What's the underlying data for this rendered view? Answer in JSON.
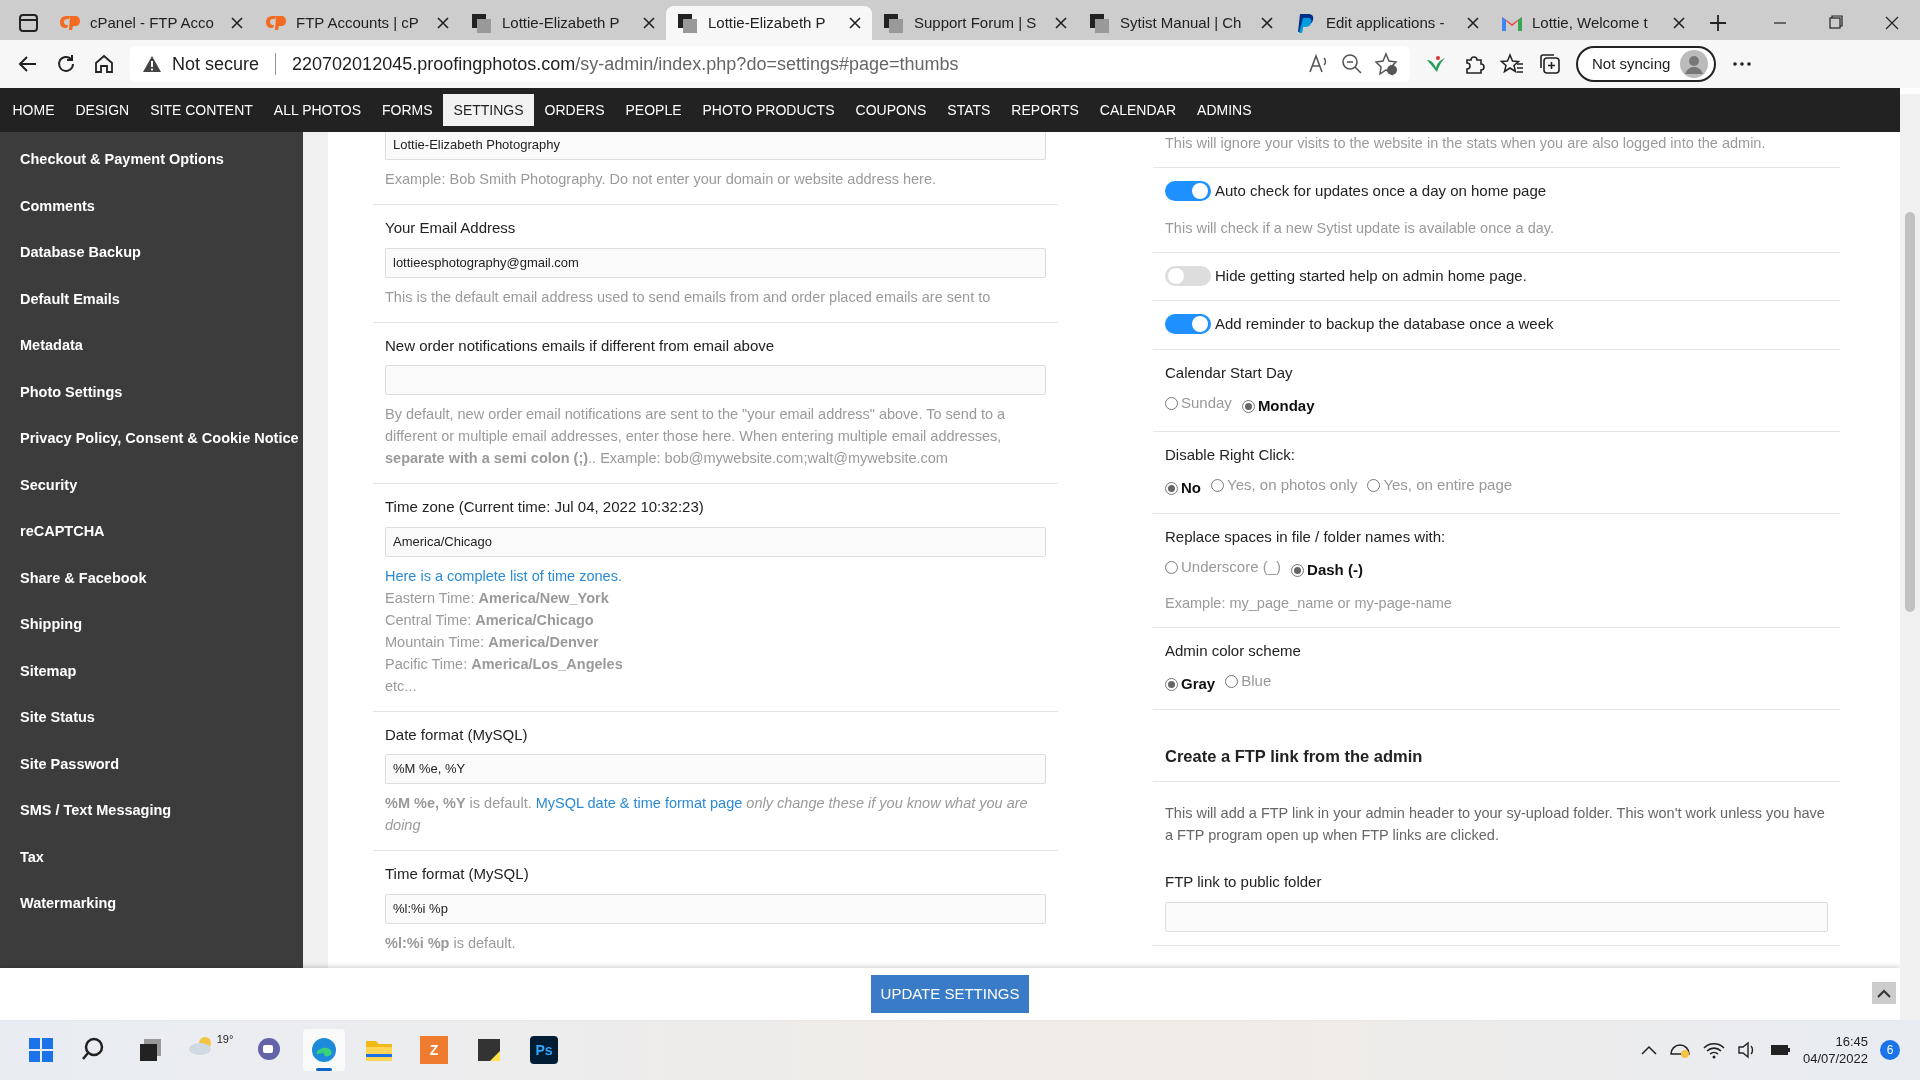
{
  "browser": {
    "tabs": [
      {
        "title": "cPanel - FTP Acco",
        "kind": "cp",
        "selected": false
      },
      {
        "title": "FTP Accounts | cP",
        "kind": "cp",
        "selected": false
      },
      {
        "title": "Lottie-Elizabeth P",
        "kind": "page",
        "selected": false
      },
      {
        "title": "Lottie-Elizabeth P",
        "kind": "page",
        "selected": true
      },
      {
        "title": "Support Forum | S",
        "kind": "page",
        "selected": false
      },
      {
        "title": "Sytist Manual | Ch",
        "kind": "page",
        "selected": false
      },
      {
        "title": "Edit applications -",
        "kind": "pp",
        "selected": false
      },
      {
        "title": "Lottie, Welcome t",
        "kind": "mail",
        "selected": false
      }
    ],
    "security": "Not secure",
    "url_host": "220702012045.proofingphotos.com",
    "url_path": "/sy-admin/index.php?do=settings#page=thumbs",
    "profile": "Not syncing"
  },
  "admin_nav": [
    {
      "label": "HOME",
      "selected": false
    },
    {
      "label": "DESIGN",
      "selected": false
    },
    {
      "label": "SITE CONTENT",
      "selected": false
    },
    {
      "label": "ALL PHOTOS",
      "selected": false
    },
    {
      "label": "FORMS",
      "selected": false
    },
    {
      "label": "SETTINGS",
      "selected": true
    },
    {
      "label": "ORDERS",
      "selected": false
    },
    {
      "label": "PEOPLE",
      "selected": false
    },
    {
      "label": "PHOTO PRODUCTS",
      "selected": false
    },
    {
      "label": "COUPONS",
      "selected": false
    },
    {
      "label": "STATS",
      "selected": false
    },
    {
      "label": "REPORTS",
      "selected": false
    },
    {
      "label": "CALENDAR",
      "selected": false
    },
    {
      "label": "ADMINS",
      "selected": false
    }
  ],
  "sidebar": [
    "Checkout & Payment Options",
    "Comments",
    "Database Backup",
    "Default Emails",
    "Metadata",
    "Photo Settings",
    "Privacy Policy, Consent & Cookie Notice",
    "Security",
    "reCAPTCHA",
    "Share & Facebook",
    "Shipping",
    "Sitemap",
    "Site Status",
    "Site Password",
    "SMS / Text Messaging",
    "Tax",
    "Watermarking"
  ],
  "left_settings": [
    {
      "kind": "field",
      "value": "Lottie-Elizabeth Photography",
      "help": [
        {
          "kind": "text",
          "text": "Example: Bob Smith Photography. Do not enter your domain or website address here."
        }
      ]
    },
    {
      "kind": "field",
      "label": "Your Email Address",
      "value": "lottieesphotography@gmail.com",
      "help": [
        {
          "kind": "text",
          "text": "This is the default email address used to send emails from and order placed emails are sent to"
        }
      ]
    },
    {
      "kind": "field",
      "label": "New order notifications emails if different from email above",
      "help": [
        {
          "kind": "text",
          "text": "By default, new order email notifications are sent to the \"your email address\" above. To send to a different or multiple email addresses, enter those here. When entering multiple email addresses, **separate with a semi colon (;)**.. Example: bob@mywebsite.com;walt@mywebsite.com"
        }
      ]
    },
    {
      "kind": "field",
      "label": "Time zone (Current time: Jul 04, 2022 10:32:23)",
      "value": "America/Chicago",
      "link": "Here is a complete list of time zones.",
      "lines": [
        "Eastern Time: **America/New_York**",
        "Central Time: **America/Chicago**",
        "Mountain Time: **America/Denver**",
        "Pacific Time: **America/Los_Angeles**",
        "etc..."
      ]
    },
    {
      "kind": "field",
      "label": "Date format (MySQL)",
      "value": "%M %e, %Y",
      "help": [
        {
          "kind": "text",
          "text": "**%M %e, %Y** is default."
        },
        {
          "kind": "link",
          "text": "MySQL date & time format page"
        },
        {
          "kind": "text",
          "text": "*only change these if you know what you are doing*"
        }
      ]
    },
    {
      "kind": "field",
      "label": "Time format (MySQL)",
      "value": "%l:%i %p",
      "help": [
        {
          "kind": "text",
          "text": "**%l:%i %p** is default."
        }
      ]
    }
  ],
  "right_settings": [
    {
      "kind": "note",
      "text": "This will ignore your visits to the website in the stats when you are also logged into the admin."
    },
    {
      "kind": "toggle",
      "label": "Auto check for updates once a day on home page",
      "on": true,
      "help": "This will check if a new Sytist update is available once a day."
    },
    {
      "kind": "toggle",
      "label": "Hide getting started help on admin home page.",
      "on": false
    },
    {
      "kind": "toggle",
      "label": "Add reminder to backup the database once a week",
      "on": true
    },
    {
      "kind": "radio",
      "label": "Calendar Start Day",
      "options": [
        {
          "label": "Sunday",
          "selected": false
        },
        {
          "label": "Monday",
          "selected": true
        }
      ]
    },
    {
      "kind": "radio",
      "label": "Disable Right Click:",
      "options": [
        {
          "label": "No",
          "selected": true
        },
        {
          "label": "Yes, on photos only",
          "selected": false
        },
        {
          "label": "Yes, on entire page",
          "selected": false
        }
      ]
    },
    {
      "kind": "radio",
      "label": "Replace spaces in file / folder names with:",
      "options": [
        {
          "label": "Underscore (_)",
          "selected": false
        },
        {
          "label": "Dash (-)",
          "selected": true
        }
      ],
      "help": "Example: my_page_name or my-page-name"
    },
    {
      "kind": "radio",
      "label": "Admin color scheme",
      "options": [
        {
          "label": "Gray",
          "selected": true
        },
        {
          "label": "Blue",
          "selected": false
        }
      ]
    },
    {
      "kind": "heading",
      "text": "Create a FTP link from the admin"
    },
    {
      "kind": "paragraph",
      "text": "This will add a FTP link in your admin header to your sy-upload folder. This won't work unless you have a FTP program open up when FTP links are clicked."
    },
    {
      "kind": "field",
      "label": "FTP link to public folder"
    }
  ],
  "update_button": "UPDATE SETTINGS",
  "taskbar": {
    "apps": [
      {
        "kind": "start"
      },
      {
        "kind": "search"
      },
      {
        "kind": "taskview"
      },
      {
        "kind": "weather",
        "label": "19°"
      },
      {
        "kind": "chat"
      },
      {
        "kind": "browser",
        "selected": true
      },
      {
        "kind": "folder"
      },
      {
        "kind": "tile",
        "label": "Z"
      },
      {
        "kind": "note"
      },
      {
        "kind": "tile2",
        "label": "Ps"
      }
    ],
    "time": "16:45",
    "date": "04/07/2022",
    "badge": "6"
  }
}
